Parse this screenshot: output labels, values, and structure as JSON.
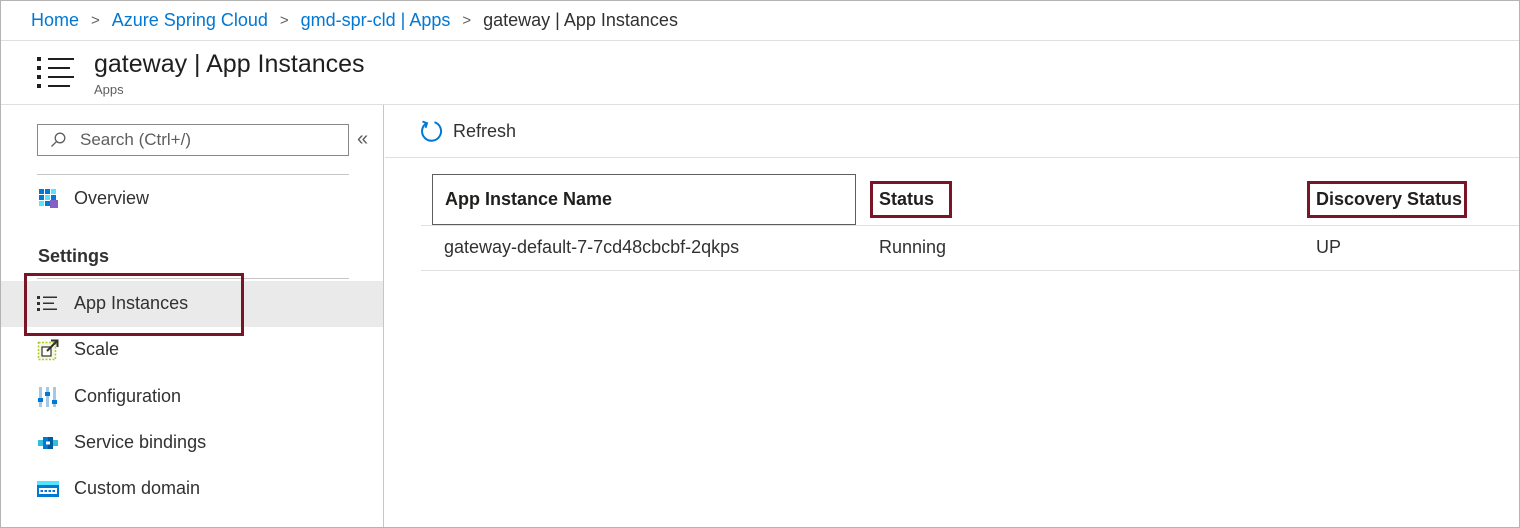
{
  "breadcrumb": {
    "items": [
      {
        "label": "Home"
      },
      {
        "label": "Azure Spring Cloud"
      },
      {
        "label": "gmd-spr-cld | Apps"
      }
    ],
    "current": "gateway | App Instances",
    "separator": ">"
  },
  "header": {
    "icon": "list-icon",
    "title": "gateway | App Instances",
    "subtitle": "Apps"
  },
  "sidebar": {
    "search": {
      "placeholder": "Search (Ctrl+/)",
      "value": ""
    },
    "collapse_label": "«",
    "top_items": [
      {
        "label": "Overview",
        "icon": "overview-grid-icon"
      }
    ],
    "section_label": "Settings",
    "settings_items": [
      {
        "label": "App Instances",
        "icon": "list-icon",
        "selected": true
      },
      {
        "label": "Scale",
        "icon": "scale-icon"
      },
      {
        "label": "Configuration",
        "icon": "configuration-sliders-icon"
      },
      {
        "label": "Service bindings",
        "icon": "service-bindings-icon"
      },
      {
        "label": "Custom domain",
        "icon": "custom-domain-www-icon"
      }
    ]
  },
  "toolbar": {
    "refresh_label": "Refresh"
  },
  "table": {
    "columns": [
      "App Instance Name",
      "Status",
      "Discovery Status"
    ],
    "rows": [
      [
        "gateway-default-7-7cd48cbcbf-2qkps",
        "Running",
        "UP"
      ]
    ]
  },
  "colors": {
    "link": "#0078d4",
    "highlight": "#7a1527",
    "selected_bg": "#eaeaea"
  }
}
